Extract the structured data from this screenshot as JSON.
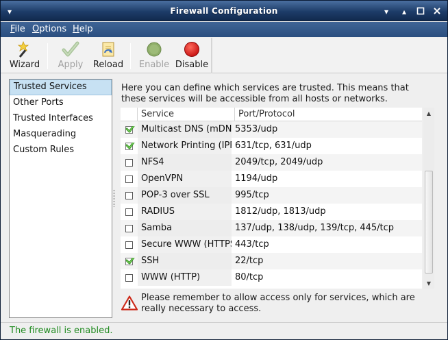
{
  "window": {
    "title": "Firewall Configuration"
  },
  "menubar": {
    "items": [
      {
        "mnemonic": "F",
        "rest": "ile"
      },
      {
        "mnemonic": "O",
        "rest": "ptions"
      },
      {
        "mnemonic": "H",
        "rest": "elp"
      }
    ]
  },
  "toolbar": {
    "wizard": {
      "label": "Wizard",
      "icon": "wand-icon",
      "enabled": true
    },
    "apply": {
      "label": "Apply",
      "icon": "checkmark-icon",
      "enabled": false
    },
    "reload": {
      "label": "Reload",
      "icon": "reload-document-icon",
      "enabled": true
    },
    "enable": {
      "label": "Enable",
      "icon": "green-circle-icon",
      "enabled": false
    },
    "disable": {
      "label": "Disable",
      "icon": "red-circle-icon",
      "enabled": true
    }
  },
  "sidebar": {
    "selected": "Trusted Services",
    "items": [
      {
        "label": "Trusted Services"
      },
      {
        "label": "Other Ports"
      },
      {
        "label": "Trusted Interfaces"
      },
      {
        "label": "Masquerading"
      },
      {
        "label": "Custom Rules"
      }
    ]
  },
  "main": {
    "description": "Here you can define which services are trusted. This means that these services will be accessible from all hosts or networks.",
    "columns": {
      "service": "Service",
      "port": "Port/Protocol"
    },
    "services": [
      {
        "service": "Multicast DNS (mDNS)",
        "port": "5353/udp",
        "checked": true
      },
      {
        "service": "Network Printing (IPP)",
        "port": "631/tcp, 631/udp",
        "checked": true
      },
      {
        "service": "NFS4",
        "port": "2049/tcp, 2049/udp",
        "checked": false
      },
      {
        "service": "OpenVPN",
        "port": "1194/udp",
        "checked": false
      },
      {
        "service": "POP-3 over SSL",
        "port": "995/tcp",
        "checked": false
      },
      {
        "service": "RADIUS",
        "port": "1812/udp, 1813/udp",
        "checked": false
      },
      {
        "service": "Samba",
        "port": "137/udp, 138/udp, 139/tcp, 445/tcp",
        "checked": false
      },
      {
        "service": "Secure WWW (HTTPS)",
        "port": "443/tcp",
        "checked": false
      },
      {
        "service": "SSH",
        "port": "22/tcp",
        "checked": true
      },
      {
        "service": "WWW (HTTP)",
        "port": "80/tcp",
        "checked": false
      }
    ],
    "warning": "Please remember to allow access only for services, which are really necessary to access."
  },
  "status": {
    "text": "The firewall is enabled.",
    "color": "#1f8a1f"
  }
}
